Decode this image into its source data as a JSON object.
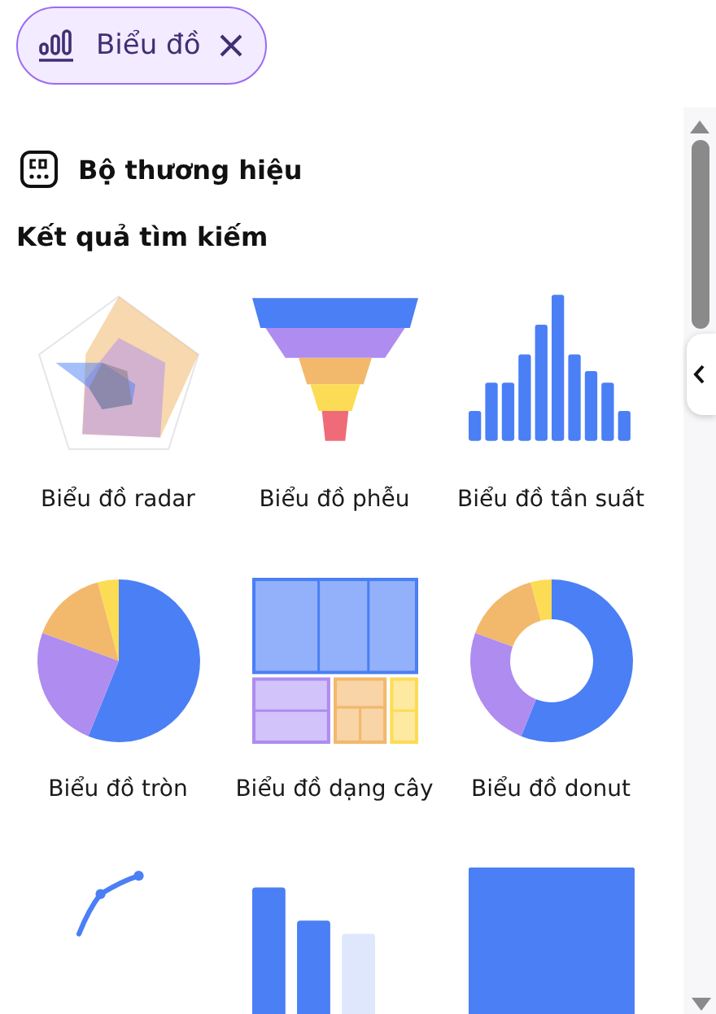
{
  "filter_chip": {
    "label": "Biểu đồ",
    "removable": true
  },
  "brand_kit": {
    "label": "Bộ thương hiệu"
  },
  "results": {
    "heading": "Kết quả tìm kiếm",
    "items": [
      {
        "kind": "radar",
        "label": "Biểu đồ radar"
      },
      {
        "kind": "funnel",
        "label": "Biểu đồ phễu"
      },
      {
        "kind": "histogram",
        "label": "Biểu đồ tần suất"
      },
      {
        "kind": "pie",
        "label": "Biểu đồ tròn"
      },
      {
        "kind": "treemap",
        "label": "Biểu đồ dạng cây"
      },
      {
        "kind": "donut",
        "label": "Biểu đồ donut"
      },
      {
        "kind": "line"
      },
      {
        "kind": "bar"
      },
      {
        "kind": "block"
      }
    ]
  }
}
